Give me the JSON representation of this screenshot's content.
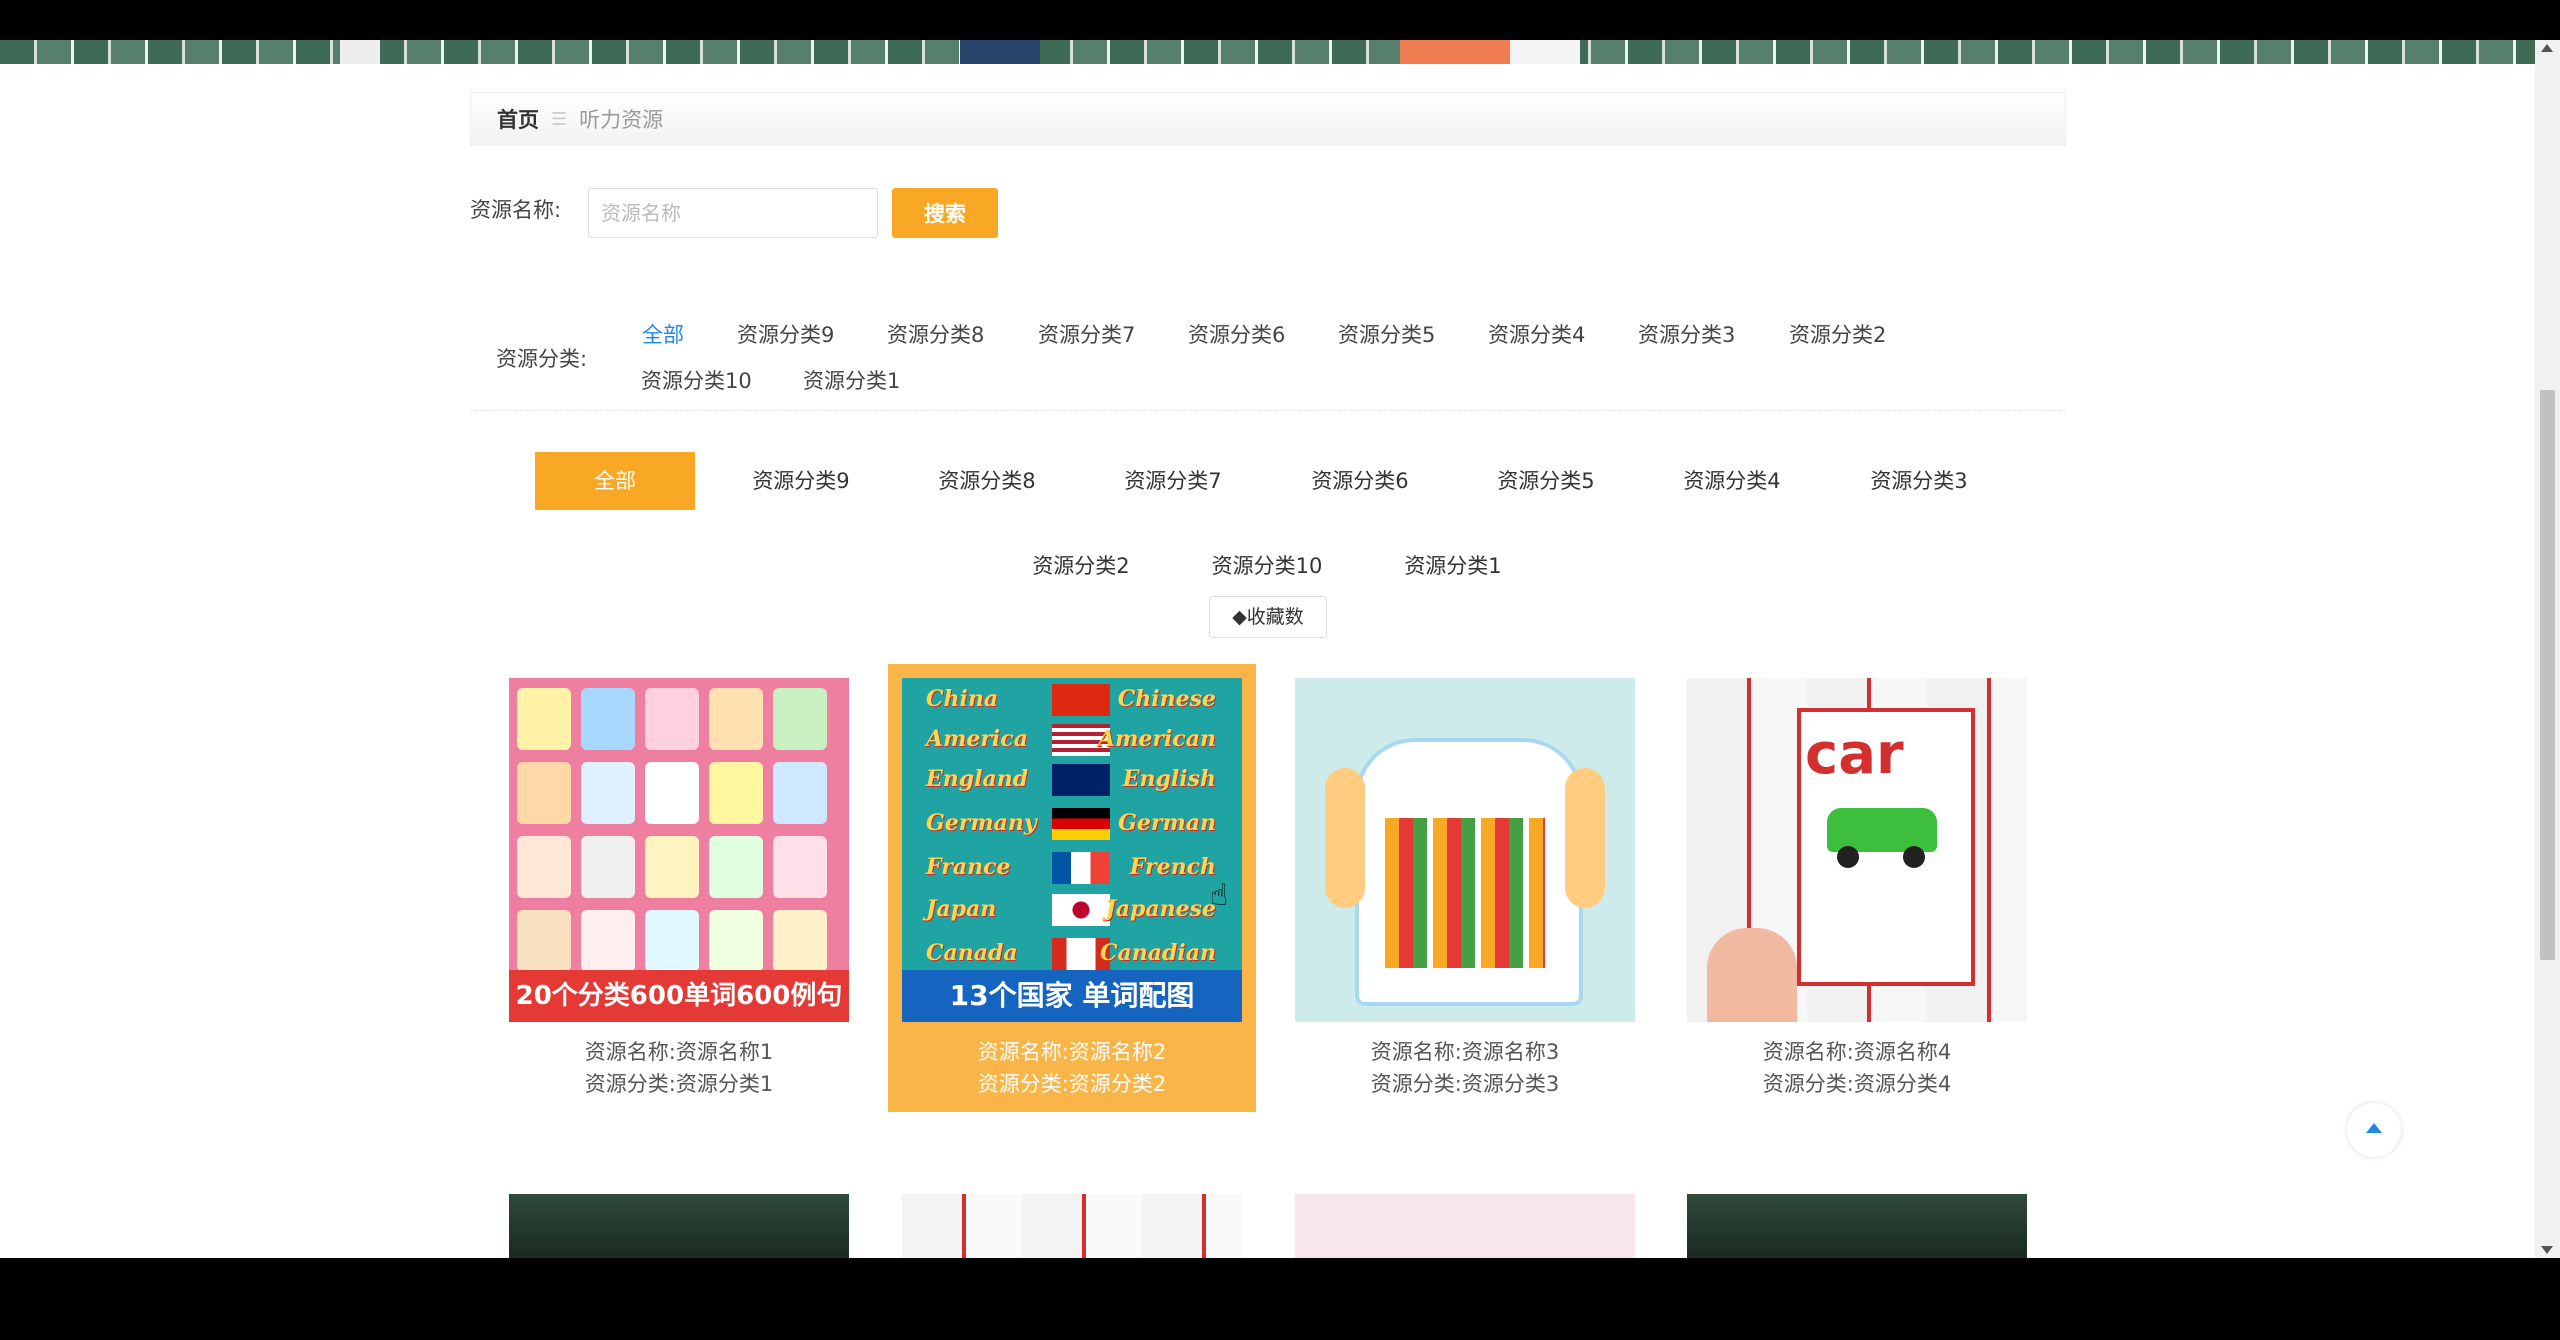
{
  "breadcrumb": {
    "home": "首页",
    "separator": "☰",
    "current": "听力资源"
  },
  "search": {
    "label": "资源名称:",
    "placeholder": "资源名称",
    "button": "搜索"
  },
  "filter": {
    "label": "资源分类:",
    "items": [
      "全部",
      "资源分类9",
      "资源分类8",
      "资源分类7",
      "资源分类6",
      "资源分类5",
      "资源分类4",
      "资源分类3",
      "资源分类2",
      "资源分类10",
      "资源分类1"
    ]
  },
  "tabs": [
    "全部",
    "资源分类9",
    "资源分类8",
    "资源分类7",
    "资源分类6",
    "资源分类5",
    "资源分类4",
    "资源分类3",
    "资源分类2",
    "资源分类10",
    "资源分类1"
  ],
  "sort": {
    "label": "◆收藏数"
  },
  "cards": [
    {
      "name": "资源名称:资源名称1",
      "category": "资源分类:资源分类1",
      "caption": "20个分类600单词600例句"
    },
    {
      "name": "资源名称:资源名称2",
      "category": "资源分类:资源分类2",
      "caption": "13个国家 单词配图"
    },
    {
      "name": "资源名称:资源名称3",
      "category": "资源分类:资源分类3"
    },
    {
      "name": "资源名称:资源名称4",
      "category": "资源分类:资源分类4",
      "word": "car"
    }
  ],
  "flags": [
    {
      "country": "China",
      "adj": "Chinese"
    },
    {
      "country": "America",
      "adj": "American"
    },
    {
      "country": "England",
      "adj": "English"
    },
    {
      "country": "Germany",
      "adj": "German"
    },
    {
      "country": "France",
      "adj": "French"
    },
    {
      "country": "Japan",
      "adj": "Japanese"
    },
    {
      "country": "Canada",
      "adj": "Canadian"
    }
  ],
  "colors": {
    "accent": "#f9a825",
    "link_active": "#1e88e5"
  }
}
